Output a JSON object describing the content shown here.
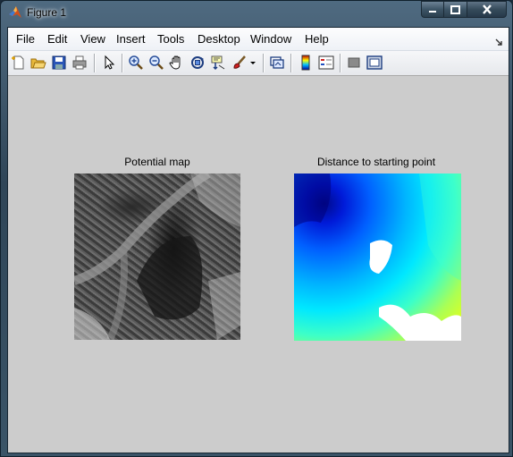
{
  "window": {
    "title": "Figure 1"
  },
  "menubar": {
    "items": [
      "File",
      "Edit",
      "View",
      "Insert",
      "Tools",
      "Desktop",
      "Window",
      "Help"
    ]
  },
  "toolbar": {
    "buttons": [
      "new-figure-icon",
      "open-file-icon",
      "save-icon",
      "print-icon",
      "edit-plot-arrow-icon",
      "zoom-in-icon",
      "zoom-out-icon",
      "pan-hand-icon",
      "rotate-3d-icon",
      "data-cursor-icon",
      "brush-icon",
      "brush-dropdown-icon",
      "link-plot-icon",
      "insert-colorbar-icon",
      "insert-legend-icon",
      "hide-plot-tools-icon",
      "show-plot-tools-icon"
    ]
  },
  "figure": {
    "left_axes": {
      "title": "Potential map"
    },
    "right_axes": {
      "title": "Distance to starting point"
    }
  },
  "colors": {
    "figure_background": "#cccccc",
    "colormap": [
      "#00008f",
      "#0000ff",
      "#00ffff",
      "#ffff00",
      "#ffffff"
    ]
  }
}
